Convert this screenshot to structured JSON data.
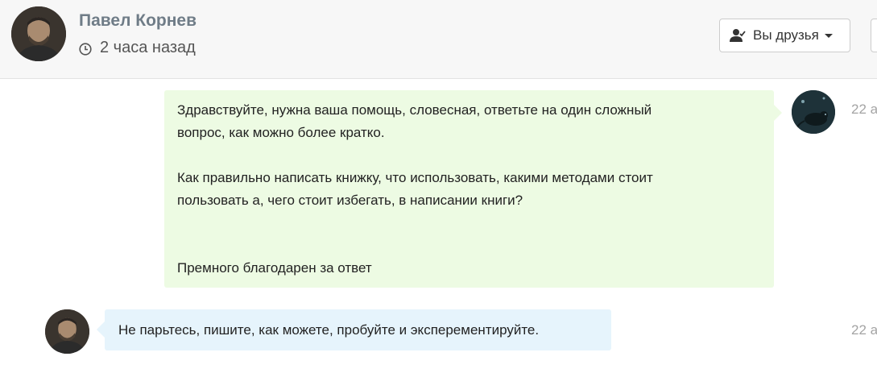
{
  "header": {
    "name": "Павел Корнев",
    "last_seen": "2 часа назад",
    "friends_button_label": "Вы друзья",
    "icons": {
      "clock": "clock-icon",
      "friend_status": "user-check-icon",
      "dropdown": "caret-down-icon"
    }
  },
  "messages": [
    {
      "direction": "outgoing",
      "paragraphs": [
        "Здравствуйте, нужна ваша помощь, словесная, ответьте на один сложный",
        "вопрос, как можно более кратко.",
        "Как правильно написать книжку, что использовать, какими методами стоит",
        "пользовать а, чего стоит избегать, в написании книги?",
        "Премного благодарен за ответ"
      ],
      "time": "22 а"
    },
    {
      "direction": "incoming",
      "text": "Не парьтесь, пишите, как можете, пробуйте и эксперементируйте.",
      "time": "22 а"
    }
  ],
  "colors": {
    "outgoing_bubble": "#edfbe3",
    "incoming_bubble": "#e6f4fc",
    "header_bg": "#f7f7f7",
    "name_color": "#6f7c87",
    "time_color": "#a4a4a4"
  }
}
